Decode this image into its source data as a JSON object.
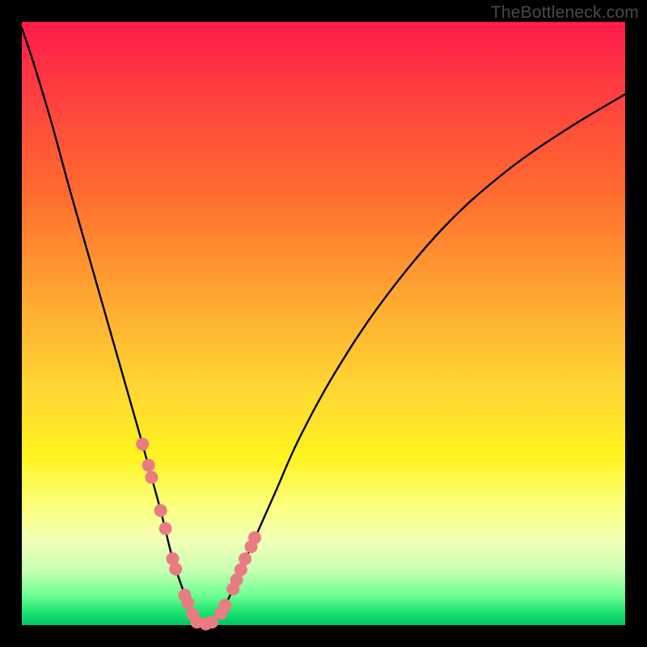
{
  "watermark": "TheBottleneck.com",
  "chart_data": {
    "type": "line",
    "title": "",
    "xlabel": "",
    "ylabel": "",
    "xlim": [
      0,
      100
    ],
    "ylim": [
      0,
      100
    ],
    "grid": false,
    "legend": false,
    "background_gradient": {
      "direction": "vertical",
      "stops": [
        {
          "pos": 0,
          "color": "#ff1a4b"
        },
        {
          "pos": 28,
          "color": "#ff6a2e"
        },
        {
          "pos": 60,
          "color": "#ffd433"
        },
        {
          "pos": 80,
          "color": "#fbff7a"
        },
        {
          "pos": 95,
          "color": "#6fff93"
        },
        {
          "pos": 100,
          "color": "#00c565"
        }
      ]
    },
    "series": [
      {
        "name": "bottleneck-curve",
        "color": "#000000",
        "x": [
          0,
          2,
          5,
          8,
          12,
          16,
          20,
          23,
          25,
          27,
          28,
          29,
          30,
          31.5,
          33,
          35,
          38,
          42,
          46,
          52,
          60,
          70,
          80,
          90,
          100
        ],
        "y": [
          99,
          93,
          83,
          72,
          58,
          44,
          30,
          19,
          11,
          5,
          2,
          0.5,
          0,
          0.5,
          2,
          6,
          13,
          22,
          31,
          42,
          54,
          66,
          75,
          82,
          88
        ]
      }
    ],
    "markers": {
      "name": "highlighted-points",
      "color": "#e97b83",
      "radius_px": 8,
      "x": [
        20.0,
        21.0,
        21.5,
        23.0,
        23.8,
        25.0,
        25.5,
        27.0,
        27.5,
        28.3,
        29.0,
        30.5,
        31.5,
        33.0,
        33.7,
        35.0,
        35.6,
        36.3,
        37.0,
        38.0,
        38.6
      ],
      "y": [
        30.0,
        26.5,
        24.5,
        19.0,
        16.0,
        11.0,
        9.3,
        5.0,
        3.7,
        1.8,
        0.5,
        0.2,
        0.5,
        2.0,
        3.3,
        6.0,
        7.5,
        9.2,
        11.0,
        13.0,
        14.5
      ]
    }
  }
}
